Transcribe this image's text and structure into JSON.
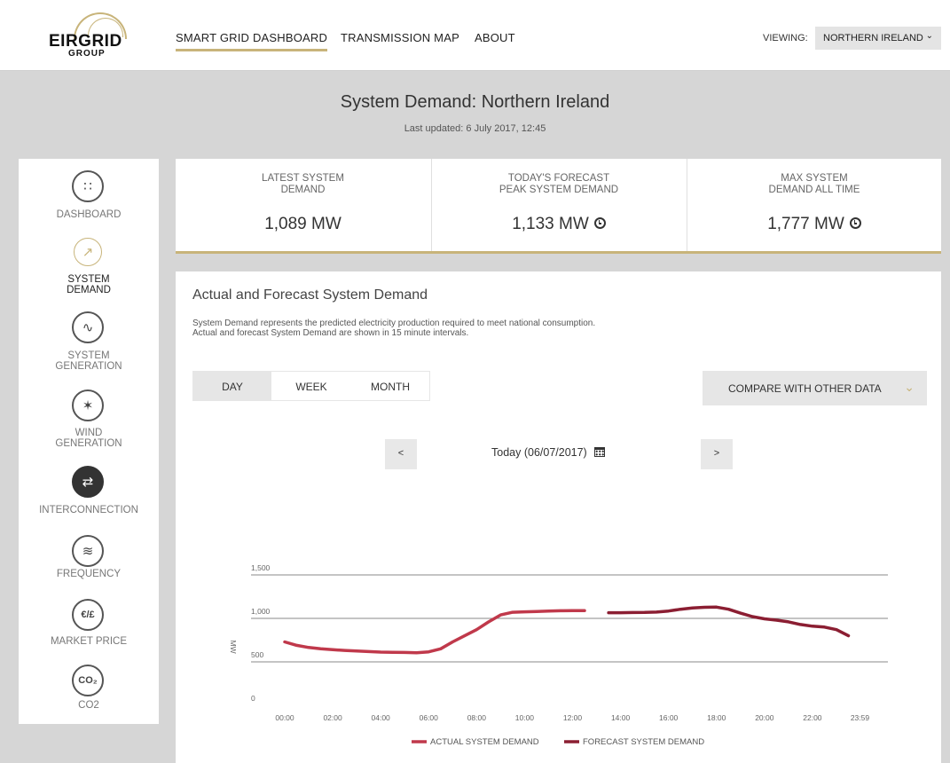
{
  "header": {
    "logo_main": "EIRGRID",
    "logo_sub": "GROUP",
    "nav": [
      {
        "label": "SMART GRID DASHBOARD",
        "active": true
      },
      {
        "label": "TRANSMISSION MAP",
        "active": false
      },
      {
        "label": "ABOUT",
        "active": false
      }
    ],
    "viewing_label": "VIEWING:",
    "viewing_value": "NORTHERN IRELAND"
  },
  "page": {
    "title": "System Demand: Northern Ireland",
    "last_updated": "Last updated: 6 July 2017, 12:45"
  },
  "sidebar": {
    "items": [
      {
        "label_1": "DASHBOARD",
        "label_2": "",
        "icon": "grid-icon",
        "glyph": "∷",
        "active": false
      },
      {
        "label_1": "SYSTEM",
        "label_2": "DEMAND",
        "icon": "line-chart-icon",
        "glyph": "↗",
        "active": true
      },
      {
        "label_1": "SYSTEM",
        "label_2": "GENERATION",
        "icon": "sine-wave-icon",
        "glyph": "∿",
        "active": false
      },
      {
        "label_1": "WIND",
        "label_2": "GENERATION",
        "icon": "wind-turbine-icon",
        "glyph": "✶",
        "active": false
      },
      {
        "label_1": "INTERCONNECTION",
        "label_2": "",
        "icon": "interconnection-icon",
        "glyph": "⇄",
        "active": false
      },
      {
        "label_1": "FREQUENCY",
        "label_2": "",
        "icon": "frequency-icon",
        "glyph": "≋",
        "active": false
      },
      {
        "label_1": "MARKET PRICE",
        "label_2": "",
        "icon": "currency-icon",
        "glyph": "€/£",
        "active": false
      },
      {
        "label_1": "CO2",
        "label_2": "",
        "icon": "co2-icon",
        "glyph": "CO₂",
        "active": false
      }
    ]
  },
  "kpis": [
    {
      "label_1": "LATEST SYSTEM",
      "label_2": "DEMAND",
      "value": "1,089 MW",
      "has_clock": false
    },
    {
      "label_1": "TODAY'S FORECAST",
      "label_2": "PEAK SYSTEM DEMAND",
      "value": "1,133 MW",
      "has_clock": true
    },
    {
      "label_1": "MAX SYSTEM",
      "label_2": "DEMAND ALL TIME",
      "value": "1,777 MW",
      "has_clock": true
    }
  ],
  "panel": {
    "title": "Actual and Forecast System Demand",
    "desc_1": "System Demand represents the predicted electricity production required to meet national consumption.",
    "desc_2": "Actual and forecast System Demand are shown in 15 minute intervals.",
    "tabs": [
      {
        "label": "DAY",
        "active": true
      },
      {
        "label": "WEEK",
        "active": false
      },
      {
        "label": "MONTH",
        "active": false
      }
    ],
    "compare_label": "COMPARE WITH OTHER DATA",
    "prev_label": "<",
    "next_label": ">",
    "date_label": "Today (06/07/2017)"
  },
  "colors": {
    "accent": "#c8b47a",
    "actual": "#c0394b",
    "forecast": "#8b1e32"
  },
  "chart_data": {
    "type": "line",
    "ylabel": "MW",
    "ylim": [
      0,
      1500
    ],
    "yticks": [
      "0",
      "500",
      "1,000",
      "1,500"
    ],
    "ytick_values": [
      0,
      500,
      1000,
      1500
    ],
    "xticks": [
      "00:00",
      "02:00",
      "04:00",
      "06:00",
      "08:00",
      "10:00",
      "12:00",
      "14:00",
      "16:00",
      "18:00",
      "20:00",
      "22:00",
      "23:59"
    ],
    "xtick_hours": [
      0,
      2,
      4,
      6,
      8,
      10,
      12,
      14,
      16,
      18,
      20,
      22,
      23.98
    ],
    "xlim": [
      0,
      24
    ],
    "grid": true,
    "legend_position": "bottom",
    "series": [
      {
        "name": "ACTUAL SYSTEM DEMAND",
        "x": [
          0,
          0.5,
          1,
          1.5,
          2,
          2.5,
          3,
          3.5,
          4,
          4.5,
          5,
          5.5,
          6,
          6.5,
          7,
          7.5,
          8,
          8.5,
          9,
          9.5,
          10,
          10.5,
          11,
          11.5,
          12,
          12.5
        ],
        "y": [
          730,
          690,
          665,
          650,
          640,
          632,
          625,
          618,
          612,
          610,
          608,
          604,
          615,
          650,
          730,
          800,
          870,
          960,
          1040,
          1070,
          1075,
          1080,
          1085,
          1088,
          1089,
          1089
        ]
      },
      {
        "name": "FORECAST SYSTEM DEMAND",
        "x": [
          13.5,
          14,
          14.5,
          15,
          15.5,
          16,
          16.5,
          17,
          17.5,
          18,
          18.5,
          19,
          19.5,
          20,
          20.5,
          21,
          21.5,
          22,
          22.5,
          23,
          23.5
        ],
        "y": [
          1065,
          1065,
          1067,
          1068,
          1072,
          1085,
          1105,
          1120,
          1128,
          1130,
          1105,
          1060,
          1020,
          995,
          980,
          960,
          930,
          910,
          900,
          870,
          800
        ]
      }
    ]
  }
}
